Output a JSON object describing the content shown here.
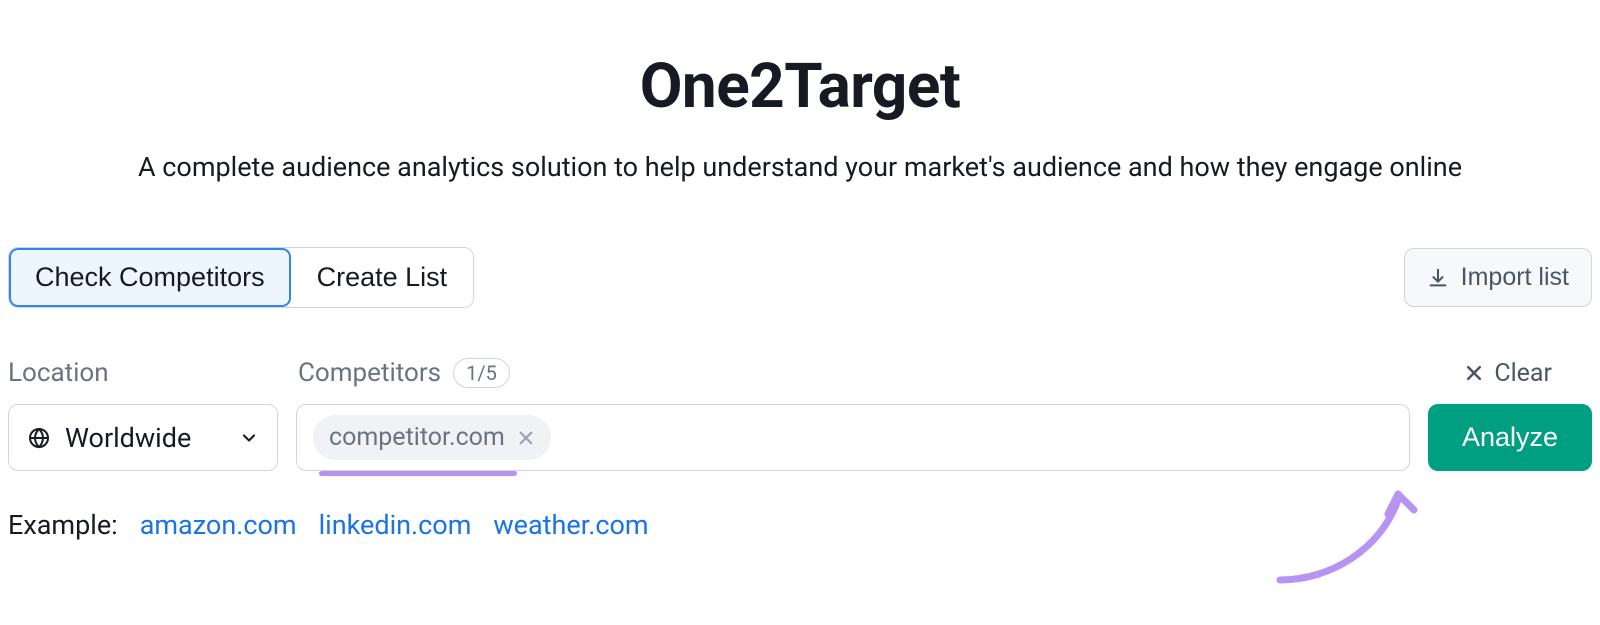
{
  "header": {
    "title": "One2Target",
    "subtitle": "A complete audience analytics solution to help understand your market's audience and how they engage online"
  },
  "tabs": {
    "check_competitors": "Check Competitors",
    "create_list": "Create List"
  },
  "import_button": "Import list",
  "labels": {
    "location": "Location",
    "competitors": "Competitors",
    "count": "1/5",
    "clear": "Clear"
  },
  "location_select": {
    "value": "Worldwide"
  },
  "competitor_chip": {
    "text": "competitor.com"
  },
  "analyze_button": "Analyze",
  "examples": {
    "label": "Example:",
    "items": [
      "amazon.com",
      "linkedin.com",
      "weather.com"
    ]
  }
}
